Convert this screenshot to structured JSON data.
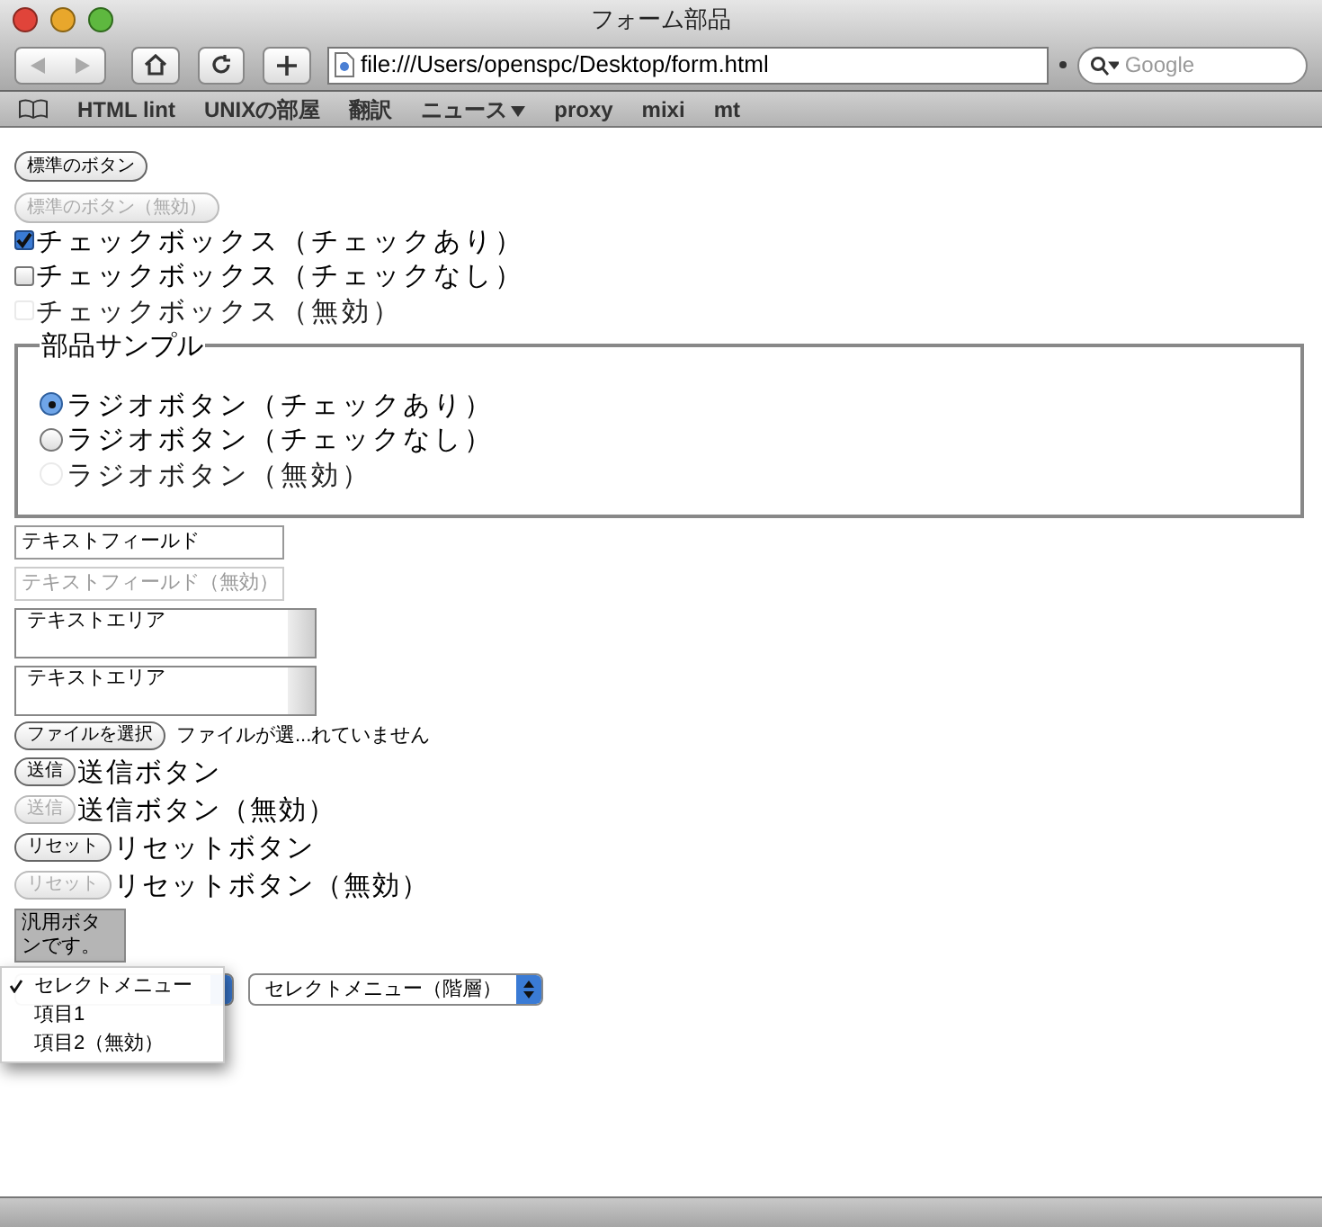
{
  "window": {
    "title": "フォーム部品"
  },
  "toolbar": {
    "address": "file:///Users/openspc/Desktop/form.html",
    "search": {
      "placeholder": "Google"
    }
  },
  "bookmarks": [
    {
      "label": "HTML lint",
      "kind": "link"
    },
    {
      "label": "UNIXの部屋",
      "kind": "link"
    },
    {
      "label": "翻訳",
      "kind": "link"
    },
    {
      "label": "ニュース",
      "kind": "menu"
    },
    {
      "label": "proxy",
      "kind": "link"
    },
    {
      "label": "mixi",
      "kind": "link"
    },
    {
      "label": "mt",
      "kind": "link"
    }
  ],
  "form": {
    "buttons": [
      {
        "label": "標準のボタン",
        "disabled": false
      },
      {
        "label": "標準のボタン（無効）",
        "disabled": true
      }
    ],
    "checkboxes": [
      {
        "label": "チェックボックス（チェックあり）",
        "checked": true,
        "disabled": false
      },
      {
        "label": "チェックボックス（チェックなし）",
        "checked": false,
        "disabled": false
      },
      {
        "label": "チェックボックス（無効）",
        "checked": false,
        "disabled": true
      }
    ],
    "fieldset": {
      "legend": "部品サンプル",
      "radios": [
        {
          "label": "ラジオボタン（チェックあり）",
          "selected": true,
          "disabled": false
        },
        {
          "label": "ラジオボタン（チェックなし）",
          "selected": false,
          "disabled": false
        },
        {
          "label": "ラジオボタン（無効）",
          "selected": false,
          "disabled": true
        }
      ]
    },
    "text_fields": [
      {
        "value": "テキストフィールド",
        "disabled": false
      },
      {
        "value": "テキストフィールド（無効）",
        "disabled": true
      }
    ],
    "text_areas": [
      {
        "value": "テキストエリア"
      },
      {
        "value": "テキストエリア"
      }
    ],
    "file_input": {
      "button": "ファイルを選択",
      "status": "ファイルが選...れていません"
    },
    "labeled_buttons": [
      {
        "button": "送信",
        "label": "送信ボタン",
        "disabled": false
      },
      {
        "button": "送信",
        "label": "送信ボタン（無効）",
        "disabled": true
      },
      {
        "button": "リセット",
        "label": "リセットボタン",
        "disabled": false
      },
      {
        "button": "リセット",
        "label": "リセットボタン（無効）",
        "disabled": true
      }
    ],
    "generic_button": {
      "label": "汎用ボタンです。"
    },
    "select_menu": {
      "expanded": true,
      "options": [
        {
          "label": "セレクトメニュー",
          "selected": true
        },
        {
          "label": "項目1",
          "selected": false
        },
        {
          "label": "項目2（無効）",
          "selected": false
        }
      ]
    },
    "select_menu_2": {
      "value": "セレクトメニュー（階層）"
    }
  }
}
